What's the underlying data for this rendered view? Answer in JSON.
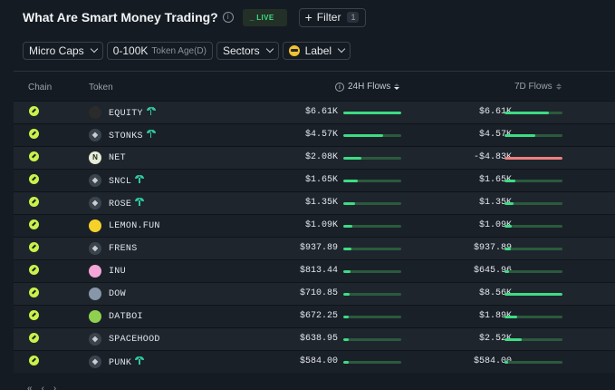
{
  "header": {
    "title": "What Are Smart Money Trading?",
    "info": "i",
    "live": "LIVE",
    "filter_label": "Filter",
    "filter_count": "1"
  },
  "controls": {
    "cap": "Micro Caps",
    "age_value": "0-100K",
    "age_label": "Token Age(D)",
    "sectors": "Sectors",
    "label": "Label"
  },
  "table": {
    "columns": {
      "chain": "Chain",
      "token": "Token",
      "flows24": "24H Flows",
      "flows7d": "7D Flows"
    },
    "rows": [
      {
        "token": "EQUITY",
        "icon": "frog",
        "sprout": true,
        "flow24": "$6.61K",
        "bar24": 1.0,
        "flow7d": "$6.61K",
        "bar7d": 0.77,
        "neg7d": false
      },
      {
        "token": "STONKS",
        "icon": "diamond",
        "sprout": true,
        "flow24": "$4.57K",
        "bar24": 0.69,
        "flow7d": "$4.57K",
        "bar7d": 0.53,
        "neg7d": false
      },
      {
        "token": "NET",
        "icon": "n",
        "sprout": false,
        "flow24": "$2.08K",
        "bar24": 0.31,
        "flow7d": "-$4.83K",
        "bar7d": 1.0,
        "neg7d": true
      },
      {
        "token": "SNCL",
        "icon": "diamond",
        "sprout": true,
        "flow24": "$1.65K",
        "bar24": 0.25,
        "flow7d": "$1.65K",
        "bar7d": 0.19,
        "neg7d": false
      },
      {
        "token": "ROSE",
        "icon": "diamond",
        "sprout": true,
        "flow24": "$1.35K",
        "bar24": 0.2,
        "flow7d": "$1.35K",
        "bar7d": 0.16,
        "neg7d": false
      },
      {
        "token": "LEMON.FUN",
        "icon": "lemon",
        "sprout": false,
        "flow24": "$1.09K",
        "bar24": 0.16,
        "flow7d": "$1.09K",
        "bar7d": 0.13,
        "neg7d": false
      },
      {
        "token": "FRENS",
        "icon": "diamond",
        "sprout": false,
        "flow24": "$937.89",
        "bar24": 0.14,
        "flow7d": "$937.89",
        "bar7d": 0.11,
        "neg7d": false
      },
      {
        "token": "INU",
        "icon": "pink",
        "sprout": false,
        "flow24": "$813.44",
        "bar24": 0.12,
        "flow7d": "$645.96",
        "bar7d": 0.08,
        "neg7d": false
      },
      {
        "token": "DOW",
        "icon": "photo",
        "sprout": false,
        "flow24": "$710.85",
        "bar24": 0.11,
        "flow7d": "$8.56K",
        "bar7d": 1.0,
        "neg7d": false
      },
      {
        "token": "DATBOI",
        "icon": "green",
        "sprout": false,
        "flow24": "$672.25",
        "bar24": 0.1,
        "flow7d": "$1.89K",
        "bar7d": 0.22,
        "neg7d": false
      },
      {
        "token": "SPACEHOOD",
        "icon": "diamond",
        "sprout": false,
        "flow24": "$638.95",
        "bar24": 0.1,
        "flow7d": "$2.52K",
        "bar7d": 0.29,
        "neg7d": false
      },
      {
        "token": "PUNK",
        "icon": "diamond",
        "sprout": true,
        "flow24": "$584.00",
        "bar24": 0.09,
        "flow7d": "$584.00",
        "bar7d": 0.07,
        "neg7d": false
      }
    ]
  },
  "colors": {
    "positive": "#3ddc84",
    "negative": "#f07f7f",
    "chain": "#c8f24a"
  }
}
